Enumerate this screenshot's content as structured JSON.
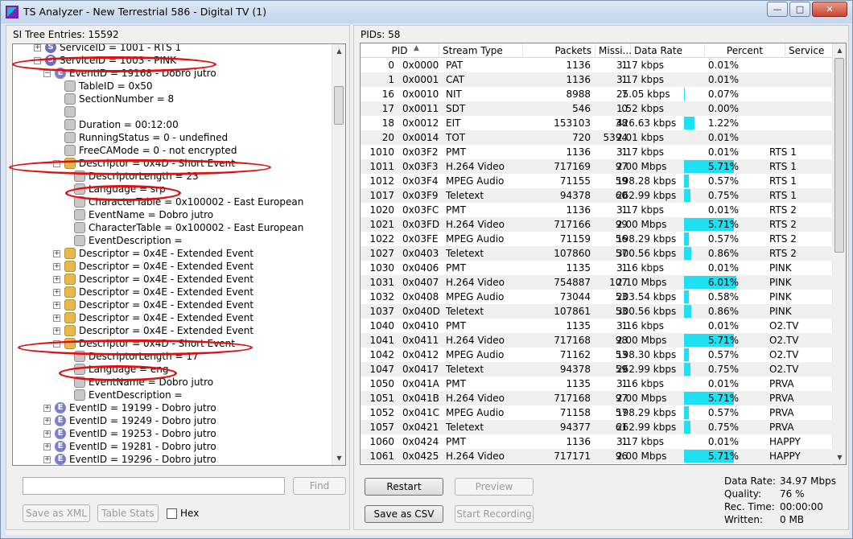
{
  "window": {
    "title": "TS Analyzer - New Terrestrial 586 - Digital TV (1)"
  },
  "left": {
    "title": "SI Tree Entries: 15592",
    "tree": [
      {
        "label": "ServiceID = 1001 - RTS 1",
        "icon": "S",
        "exp": "+"
      },
      {
        "label": "ServiceID = 1003 - PINK",
        "icon": "S",
        "exp": "-"
      },
      {
        "label": "EventID = 19168 - Dobro jutro",
        "icon": "E",
        "exp": "-"
      },
      {
        "label": "TableID = 0x50",
        "icon": "P",
        "exp": ""
      },
      {
        "label": "SectionNumber = 8",
        "icon": "P",
        "exp": ""
      },
      {
        "label": "",
        "icon": "P",
        "exp": ""
      },
      {
        "label": "Duration = 00:12:00",
        "icon": "P",
        "exp": ""
      },
      {
        "label": "RunningStatus = 0 - undefined",
        "icon": "P",
        "exp": ""
      },
      {
        "label": "FreeCAMode = 0 - not encrypted",
        "icon": "P",
        "exp": ""
      },
      {
        "label": "Descriptor = 0x4D - Short Event",
        "icon": "D",
        "exp": "-"
      },
      {
        "label": "DescriptorLength = 23",
        "icon": "P",
        "exp": ""
      },
      {
        "label": "Language = srp",
        "icon": "P",
        "exp": ""
      },
      {
        "label": "CharacterTable = 0x100002 - East European",
        "icon": "P",
        "exp": ""
      },
      {
        "label": "EventName = Dobro jutro",
        "icon": "P",
        "exp": ""
      },
      {
        "label": "CharacterTable = 0x100002 - East European",
        "icon": "P",
        "exp": ""
      },
      {
        "label": "EventDescription =",
        "icon": "P",
        "exp": ""
      },
      {
        "label": "Descriptor = 0x4E - Extended Event",
        "icon": "D",
        "exp": "+"
      },
      {
        "label": "Descriptor = 0x4E - Extended Event",
        "icon": "D",
        "exp": "+"
      },
      {
        "label": "Descriptor = 0x4E - Extended Event",
        "icon": "D",
        "exp": "+"
      },
      {
        "label": "Descriptor = 0x4E - Extended Event",
        "icon": "D",
        "exp": "+"
      },
      {
        "label": "Descriptor = 0x4E - Extended Event",
        "icon": "D",
        "exp": "+"
      },
      {
        "label": "Descriptor = 0x4E - Extended Event",
        "icon": "D",
        "exp": "+"
      },
      {
        "label": "Descriptor = 0x4E - Extended Event",
        "icon": "D",
        "exp": "+"
      },
      {
        "label": "Descriptor = 0x4D - Short Event",
        "icon": "D",
        "exp": "-"
      },
      {
        "label": "DescriptorLength = 17",
        "icon": "P",
        "exp": ""
      },
      {
        "label": "Language = eng",
        "icon": "P",
        "exp": ""
      },
      {
        "label": "EventName = Dobro jutro",
        "icon": "P",
        "exp": ""
      },
      {
        "label": "EventDescription =",
        "icon": "P",
        "exp": ""
      },
      {
        "label": "EventID = 19199 - Dobro jutro",
        "icon": "E",
        "exp": "+"
      },
      {
        "label": "EventID = 19249 - Dobro jutro",
        "icon": "E",
        "exp": "+"
      },
      {
        "label": "EventID = 19253 - Dobro jutro",
        "icon": "E",
        "exp": "+"
      },
      {
        "label": "EventID = 19281 - Dobro jutro",
        "icon": "E",
        "exp": "+"
      },
      {
        "label": "EventID = 19296 - Dobro jutro",
        "icon": "E",
        "exp": "+"
      }
    ],
    "find_placeholder": "",
    "find_label": "Find",
    "save_xml_label": "Save as XML",
    "table_stats_label": "Table Stats",
    "hex_label": "Hex"
  },
  "right": {
    "title": "PIDs: 58",
    "columns": [
      "PID",
      "Stream Type",
      "Packets",
      "Missi...",
      "Data Rate",
      "Percent",
      "Service"
    ],
    "rows": [
      {
        "pid": "0",
        "hex": "0x0000",
        "type": "PAT",
        "packets": "1136",
        "missing": "1",
        "rate": "3.17 kbps",
        "percent": "0.01%",
        "pct": 0.01,
        "service": ""
      },
      {
        "pid": "1",
        "hex": "0x0001",
        "type": "CAT",
        "packets": "1136",
        "missing": "1",
        "rate": "3.17 kbps",
        "percent": "0.01%",
        "pct": 0.01,
        "service": ""
      },
      {
        "pid": "16",
        "hex": "0x0010",
        "type": "NIT",
        "packets": "8988",
        "missing": "7",
        "rate": "25.05 kbps",
        "percent": "0.07%",
        "pct": 0.07,
        "service": ""
      },
      {
        "pid": "17",
        "hex": "0x0011",
        "type": "SDT",
        "packets": "546",
        "missing": "0",
        "rate": "1.52 kbps",
        "percent": "0.00%",
        "pct": 0.0,
        "service": ""
      },
      {
        "pid": "18",
        "hex": "0x0012",
        "type": "EIT",
        "packets": "153103",
        "missing": "38",
        "rate": "426.63 kbps",
        "percent": "1.22%",
        "pct": 1.22,
        "service": ""
      },
      {
        "pid": "20",
        "hex": "0x0014",
        "type": "TOT",
        "packets": "720",
        "missing": "5394",
        "rate": "2.01 kbps",
        "percent": "0.01%",
        "pct": 0.01,
        "service": ""
      },
      {
        "pid": "1010",
        "hex": "0x03F2",
        "type": "PMT",
        "packets": "1136",
        "missing": "1",
        "rate": "3.17 kbps",
        "percent": "0.01%",
        "pct": 0.01,
        "service": "RTS 1"
      },
      {
        "pid": "1011",
        "hex": "0x03F3",
        "type": "H.264 Video",
        "packets": "717169",
        "missing": "97",
        "rate": "2.00 Mbps",
        "percent": "5.71%",
        "pct": 5.71,
        "service": "RTS 1"
      },
      {
        "pid": "1012",
        "hex": "0x03F4",
        "type": "MPEG Audio",
        "packets": "71155",
        "missing": "59",
        "rate": "198.28 kbps",
        "percent": "0.57%",
        "pct": 0.57,
        "service": "RTS 1"
      },
      {
        "pid": "1017",
        "hex": "0x03F9",
        "type": "Teletext",
        "packets": "94378",
        "missing": "60",
        "rate": "262.99 kbps",
        "percent": "0.75%",
        "pct": 0.75,
        "service": "RTS 1"
      },
      {
        "pid": "1020",
        "hex": "0x03FC",
        "type": "PMT",
        "packets": "1136",
        "missing": "1",
        "rate": "3.17 kbps",
        "percent": "0.01%",
        "pct": 0.01,
        "service": "RTS 2"
      },
      {
        "pid": "1021",
        "hex": "0x03FD",
        "type": "H.264 Video",
        "packets": "717166",
        "missing": "99",
        "rate": "2.00 Mbps",
        "percent": "5.71%",
        "pct": 5.71,
        "service": "RTS 2"
      },
      {
        "pid": "1022",
        "hex": "0x03FE",
        "type": "MPEG Audio",
        "packets": "71159",
        "missing": "56",
        "rate": "198.29 kbps",
        "percent": "0.57%",
        "pct": 0.57,
        "service": "RTS 2"
      },
      {
        "pid": "1027",
        "hex": "0x0403",
        "type": "Teletext",
        "packets": "107860",
        "missing": "57",
        "rate": "300.56 kbps",
        "percent": "0.86%",
        "pct": 0.86,
        "service": "RTS 2"
      },
      {
        "pid": "1030",
        "hex": "0x0406",
        "type": "PMT",
        "packets": "1135",
        "missing": "1",
        "rate": "3.16 kbps",
        "percent": "0.01%",
        "pct": 0.01,
        "service": "PINK"
      },
      {
        "pid": "1031",
        "hex": "0x0407",
        "type": "H.264 Video",
        "packets": "754887",
        "missing": "107",
        "rate": "2.10 Mbps",
        "percent": "6.01%",
        "pct": 6.01,
        "service": "PINK"
      },
      {
        "pid": "1032",
        "hex": "0x0408",
        "type": "MPEG Audio",
        "packets": "73044",
        "missing": "53",
        "rate": "203.54 kbps",
        "percent": "0.58%",
        "pct": 0.58,
        "service": "PINK"
      },
      {
        "pid": "1037",
        "hex": "0x040D",
        "type": "Teletext",
        "packets": "107861",
        "missing": "53",
        "rate": "300.56 kbps",
        "percent": "0.86%",
        "pct": 0.86,
        "service": "PINK"
      },
      {
        "pid": "1040",
        "hex": "0x0410",
        "type": "PMT",
        "packets": "1135",
        "missing": "1",
        "rate": "3.16 kbps",
        "percent": "0.01%",
        "pct": 0.01,
        "service": "O2.TV"
      },
      {
        "pid": "1041",
        "hex": "0x0411",
        "type": "H.264 Video",
        "packets": "717168",
        "missing": "98",
        "rate": "2.00 Mbps",
        "percent": "5.71%",
        "pct": 5.71,
        "service": "O2.TV"
      },
      {
        "pid": "1042",
        "hex": "0x0412",
        "type": "MPEG Audio",
        "packets": "71162",
        "missing": "53",
        "rate": "198.30 kbps",
        "percent": "0.57%",
        "pct": 0.57,
        "service": "O2.TV"
      },
      {
        "pid": "1047",
        "hex": "0x0417",
        "type": "Teletext",
        "packets": "94378",
        "missing": "59",
        "rate": "262.99 kbps",
        "percent": "0.75%",
        "pct": 0.75,
        "service": "O2.TV"
      },
      {
        "pid": "1050",
        "hex": "0x041A",
        "type": "PMT",
        "packets": "1135",
        "missing": "1",
        "rate": "3.16 kbps",
        "percent": "0.01%",
        "pct": 0.01,
        "service": "PRVA"
      },
      {
        "pid": "1051",
        "hex": "0x041B",
        "type": "H.264 Video",
        "packets": "717168",
        "missing": "97",
        "rate": "2.00 Mbps",
        "percent": "5.71%",
        "pct": 5.71,
        "service": "PRVA"
      },
      {
        "pid": "1052",
        "hex": "0x041C",
        "type": "MPEG Audio",
        "packets": "71158",
        "missing": "57",
        "rate": "198.29 kbps",
        "percent": "0.57%",
        "pct": 0.57,
        "service": "PRVA"
      },
      {
        "pid": "1057",
        "hex": "0x0421",
        "type": "Teletext",
        "packets": "94377",
        "missing": "61",
        "rate": "262.99 kbps",
        "percent": "0.75%",
        "pct": 0.75,
        "service": "PRVA"
      },
      {
        "pid": "1060",
        "hex": "0x0424",
        "type": "PMT",
        "packets": "1136",
        "missing": "1",
        "rate": "3.17 kbps",
        "percent": "0.01%",
        "pct": 0.01,
        "service": "HAPPY"
      },
      {
        "pid": "1061",
        "hex": "0x0425",
        "type": "H.264 Video",
        "packets": "717171",
        "missing": "96",
        "rate": "2.00 Mbps",
        "percent": "5.71%",
        "pct": 5.71,
        "service": "HAPPY"
      }
    ],
    "restart_label": "Restart",
    "preview_label": "Preview",
    "save_csv_label": "Save as CSV",
    "start_recording_label": "Start Recording",
    "stats": {
      "data_rate_label": "Data Rate:",
      "data_rate_value": "34.97 Mbps",
      "quality_label": "Quality:",
      "quality_value": "76 %",
      "rec_time_label": "Rec. Time:",
      "rec_time_value": "00:00:00",
      "written_label": "Written:",
      "written_value": "0 MB"
    }
  },
  "colors": {
    "percent_bar": "#1ee0f0",
    "highlight_ellipse": "#e01010"
  }
}
